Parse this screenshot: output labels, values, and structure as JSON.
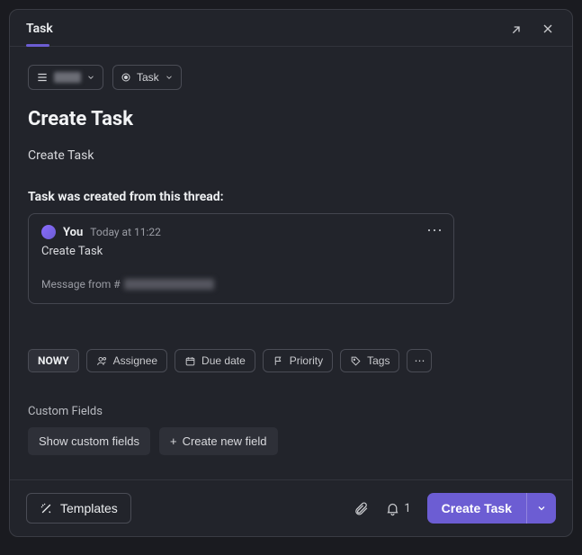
{
  "header": {
    "title": "Task"
  },
  "toolbar": {
    "list_label_redacted": true,
    "type_label": "Task"
  },
  "task": {
    "title": "Create Task",
    "description": "Create Task"
  },
  "thread": {
    "section_label": "Task was created from this thread:",
    "author": "You",
    "timestamp": "Today at 11:22",
    "body": "Create Task",
    "source_prefix": "Message from #",
    "source_channel_redacted": true
  },
  "meta": {
    "status_badge": "NOWY",
    "assignee_label": "Assignee",
    "duedate_label": "Due date",
    "priority_label": "Priority",
    "tags_label": "Tags"
  },
  "custom_fields": {
    "section_label": "Custom Fields",
    "show_label": "Show custom fields",
    "create_label": "Create new field"
  },
  "footer": {
    "templates_label": "Templates",
    "notify_count": "1",
    "cta_label": "Create Task"
  }
}
